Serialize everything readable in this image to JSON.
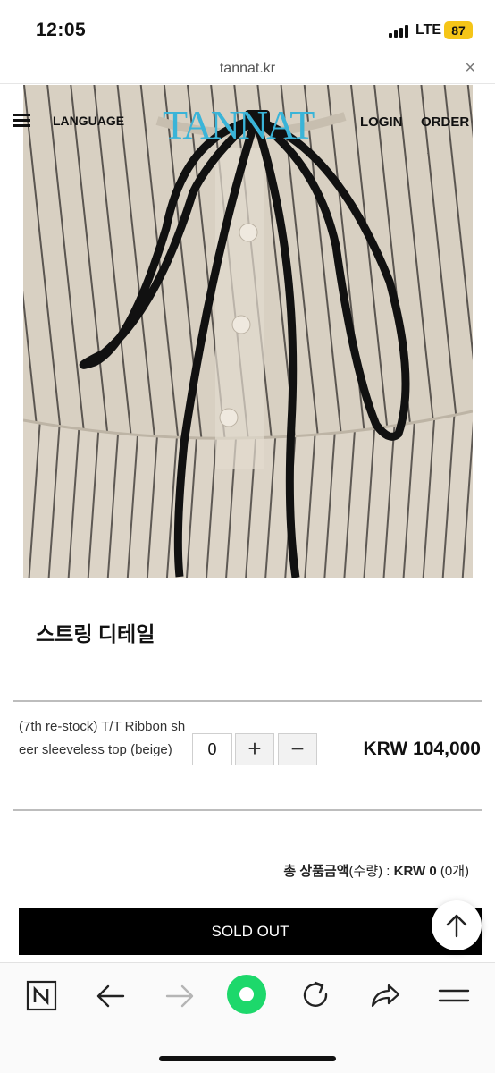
{
  "status_bar": {
    "time": "12:05",
    "network": "LTE",
    "battery": "87"
  },
  "browser": {
    "url": "tannat.kr",
    "close_symbol": "×"
  },
  "site_header": {
    "language_label": "LANGUAGE",
    "logo_text": "TANNAT",
    "login_label": "LOGIN",
    "order_label": "ORDER"
  },
  "product": {
    "detail_caption": "스트링 디테일",
    "option_name": "(7th re-stock) T/T Ribbon sheer sleeveless top (beige)",
    "quantity": "0",
    "plus_symbol": "+",
    "minus_symbol": "−",
    "price": "KRW 104,000"
  },
  "total": {
    "label_bold": "총 상품금액",
    "label_qty": "(수량) : ",
    "amount": "KRW 0",
    "count": " (0개)"
  },
  "sold_out_label": "SOLD OUT",
  "toolbar": {
    "icons": [
      "naver-n-icon",
      "back-arrow-icon",
      "forward-arrow-icon",
      "home-dot-icon",
      "refresh-icon",
      "share-icon",
      "menu-lines-icon"
    ]
  },
  "colors": {
    "logo": "#3ab4d8",
    "battery": "#f5c518",
    "home_button": "#1dd86b",
    "sold_out_bg": "#000000"
  }
}
